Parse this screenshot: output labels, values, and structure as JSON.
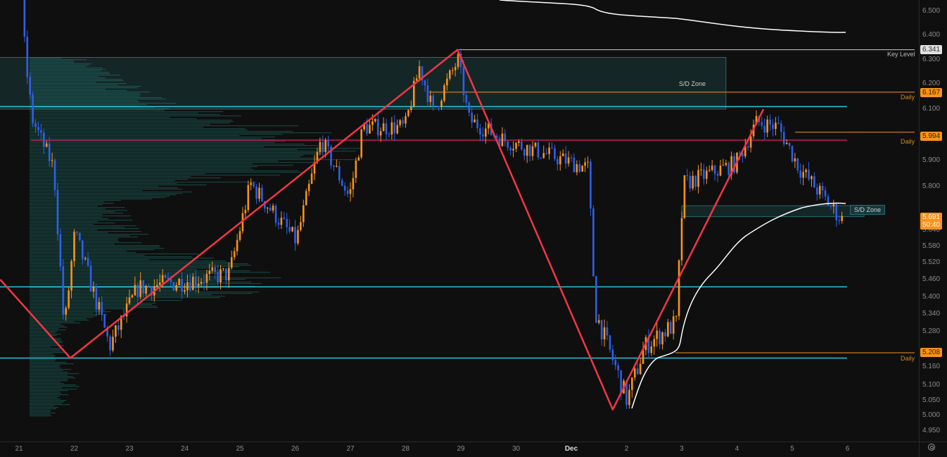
{
  "chart_data": {
    "type": "candlestick",
    "colors": {
      "up": "#f7931a",
      "down": "#2f5fe8",
      "zigzag": "#f23645",
      "cyan": "#26c6da",
      "orange": "#f7931a",
      "magenta": "#e91e63",
      "white": "#ffffff",
      "zone": "#1b3a3d"
    },
    "y_ticks": [
      "6.500",
      "6.400",
      "6.300",
      "6.200",
      "6.100",
      "5.900",
      "5.800",
      "5.640",
      "5.580",
      "5.520",
      "5.460",
      "5.400",
      "5.340",
      "5.280",
      "5.160",
      "5.100",
      "5.050",
      "5.000",
      "4.950"
    ],
    "x_ticks": [
      {
        "day": 21,
        "label": "21"
      },
      {
        "day": 22,
        "label": "22"
      },
      {
        "day": 23,
        "label": "23"
      },
      {
        "day": 24,
        "label": "24"
      },
      {
        "day": 25,
        "label": "25"
      },
      {
        "day": 26,
        "label": "26"
      },
      {
        "day": 27,
        "label": "27"
      },
      {
        "day": 28,
        "label": "28"
      },
      {
        "day": 29,
        "label": "29"
      },
      {
        "day": 30,
        "label": "30"
      },
      {
        "day": 31,
        "label": "Dec"
      },
      {
        "day": 32,
        "label": "2"
      },
      {
        "day": 33,
        "label": "3"
      },
      {
        "day": 34,
        "label": "4"
      },
      {
        "day": 35,
        "label": "5"
      },
      {
        "day": 36,
        "label": "6"
      }
    ],
    "price_path": [
      [
        21.1,
        6.55
      ],
      [
        21.17,
        6.29
      ],
      [
        21.29,
        6.06
      ],
      [
        21.68,
        5.87
      ],
      [
        21.87,
        5.28
      ],
      [
        22.06,
        5.63
      ],
      [
        22.69,
        5.23
      ],
      [
        23.2,
        5.43
      ],
      [
        24.86,
        5.48
      ],
      [
        25.24,
        5.81
      ],
      [
        26.07,
        5.6
      ],
      [
        26.52,
        5.98
      ],
      [
        27.03,
        5.76
      ],
      [
        27.28,
        6.03
      ],
      [
        28.04,
        6.03
      ],
      [
        28.3,
        6.27
      ],
      [
        28.55,
        6.09
      ],
      [
        29.0,
        6.3
      ],
      [
        29.19,
        6.06
      ],
      [
        29.83,
        5.98
      ],
      [
        31.36,
        5.87
      ],
      [
        31.48,
        5.35
      ],
      [
        32.06,
        5.05
      ],
      [
        32.38,
        5.23
      ],
      [
        32.95,
        5.31
      ],
      [
        33.08,
        5.81
      ],
      [
        34.03,
        5.89
      ],
      [
        34.41,
        6.05
      ],
      [
        34.8,
        6.03
      ],
      [
        35.18,
        5.87
      ],
      [
        35.94,
        5.68
      ]
    ],
    "zigzag": [
      [
        20.66,
        5.46
      ],
      [
        21.93,
        5.19
      ],
      [
        28.94,
        6.341
      ],
      [
        31.75,
        5.02
      ],
      [
        34.48,
        6.1
      ]
    ],
    "levels": {
      "key_level": {
        "price": 6.341,
        "tag": "6.341",
        "label": "Key Level"
      },
      "daily_1": {
        "price": 6.167,
        "tag": "6.167",
        "label": "Daily"
      },
      "daily_2": {
        "price": 5.994,
        "tag": "5.994",
        "label": "Daily"
      },
      "daily_3": {
        "price": 5.208,
        "tag": "5.208",
        "label": "Daily"
      },
      "cyan": [
        6.11,
        5.435,
        5.19
      ],
      "magenta": 5.99
    },
    "zones": [
      {
        "label": "S/D Zone",
        "top": 6.31,
        "bottom": 6.1,
        "from": 20.5,
        "to": 33.8
      },
      {
        "label": "S/D Zone",
        "top": 5.73,
        "bottom": 5.69,
        "from": 33.0,
        "to": 36.3
      }
    ],
    "current": {
      "price": "5.691",
      "countdown": "50:40"
    }
  }
}
